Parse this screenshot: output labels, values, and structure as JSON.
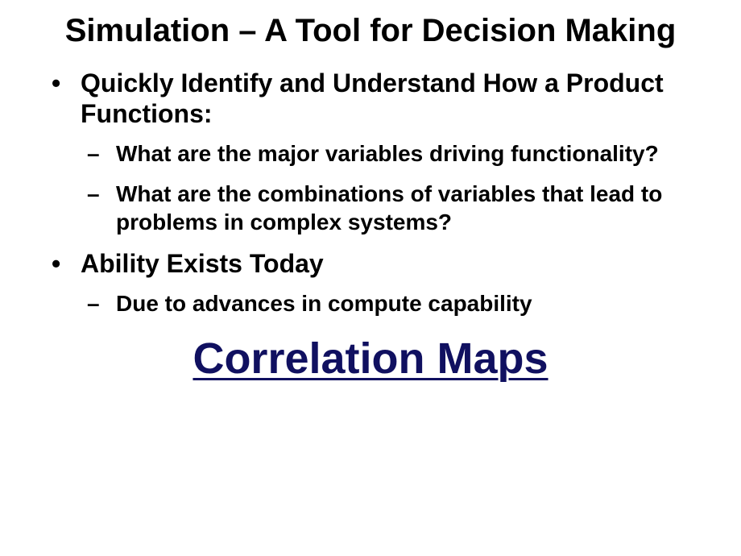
{
  "title": "Simulation – A Tool for Decision Making",
  "bullets": [
    {
      "text": "Quickly Identify and Understand How a Product Functions:",
      "sub": [
        "What are the major variables driving functionality?",
        "What are the combinations of variables that lead to problems in complex systems?"
      ]
    },
    {
      "text": "Ability Exists Today",
      "sub": [
        "Due to advances in compute capability"
      ]
    }
  ],
  "link": "Correlation Maps"
}
